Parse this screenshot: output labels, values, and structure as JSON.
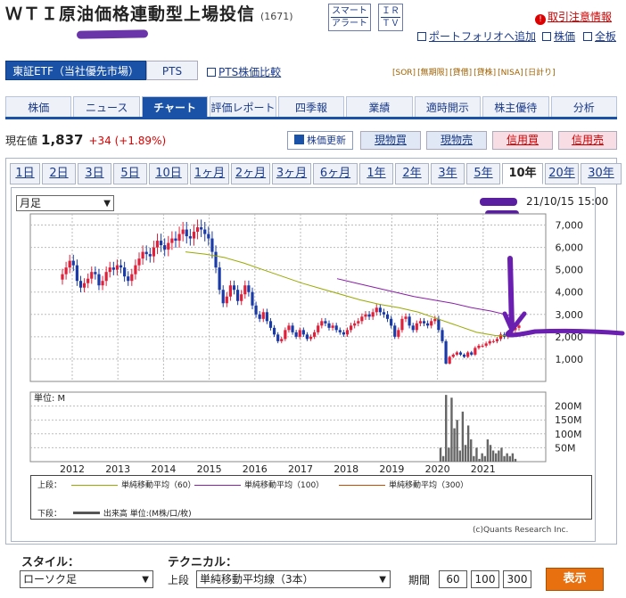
{
  "header": {
    "title": "ＷＴＩ原油価格連動型上場投信",
    "code": "(1671)",
    "smart_alert": [
      "スマート",
      "アラート"
    ],
    "ir_tv": [
      "ＩＲ",
      "ＴＶ"
    ],
    "warning": "取引注意情報",
    "portfolio_link": "ポートフォリオへ追加",
    "stock_link": "株価",
    "board_link": "全板"
  },
  "market": {
    "selected": "東証ETF（当社優先市場）",
    "pts": "PTS",
    "pts_compare": "PTS株価比較",
    "badges": [
      "[SOR]",
      "[無期限]",
      "[貸借]",
      "[貸株]",
      "[NISA]",
      "[日計り]"
    ]
  },
  "tabs": [
    {
      "label": "株価"
    },
    {
      "label": "ニュース"
    },
    {
      "label": "チャート"
    },
    {
      "label": "評価レポート"
    },
    {
      "label": "四季報"
    },
    {
      "label": "業績"
    },
    {
      "label": "適時開示"
    },
    {
      "label": "株主優待"
    },
    {
      "label": "分析"
    }
  ],
  "quote": {
    "label": "現在値",
    "price": "1,837",
    "change": "+34 (+1.89%)",
    "update": "株価更新",
    "buttons": [
      "現物買",
      "現物売",
      "信用買",
      "信用売"
    ]
  },
  "periods": [
    "1日",
    "2日",
    "3日",
    "5日",
    "10日",
    "1ヶ月",
    "2ヶ月",
    "3ヶ月",
    "6ヶ月",
    "1年",
    "2年",
    "3年",
    "5年",
    "10年",
    "20年",
    "30年"
  ],
  "active_period": "10年",
  "chart": {
    "interval": "月足",
    "timestamp": "21/10/15 15:00",
    "volume_unit": "単位: M",
    "legend_upper_label": "上段：",
    "legend_lower_label": "下段：",
    "ma_labels": [
      "単純移動平均（60）",
      "単純移動平均（100）",
      "単純移動平均（300）"
    ],
    "volume_label": "出来高 単位:(M株/口/枚)",
    "copyright": "(c)Quants Research Inc.",
    "colors": {
      "up": "#e0203a",
      "down": "#1a3aa8",
      "ma60": "#9aa800",
      "ma100": "#8a1fa8",
      "ma300": "#c84a00"
    }
  },
  "chart_data": {
    "type": "candlestick",
    "y_ticks": [
      "7,000",
      "6,000",
      "5,000",
      "4,000",
      "3,000",
      "2,000",
      "1,000"
    ],
    "ylim": [
      0,
      7500
    ],
    "x_ticks": [
      "2012",
      "2013",
      "2014",
      "2015",
      "2016",
      "2017",
      "2018",
      "2019",
      "2020",
      "2021"
    ],
    "volume_ticks": [
      "200M",
      "150M",
      "100M",
      "50M"
    ],
    "volume_ylim": [
      0,
      250
    ],
    "series": [
      {
        "name": "単純移動平均（60）"
      },
      {
        "name": "単純移動平均（100）"
      },
      {
        "name": "単純移動平均（300）"
      }
    ],
    "close": [
      4800,
      5100,
      5400,
      5200,
      4500,
      4200,
      4400,
      4600,
      4900,
      4800,
      4300,
      4500,
      4900,
      5100,
      5000,
      5200,
      5100,
      4700,
      4500,
      4800,
      5200,
      5500,
      5800,
      5700,
      5600,
      6000,
      6300,
      6100,
      5900,
      6200,
      6400,
      6300,
      6600,
      6800,
      6500,
      6400,
      6700,
      6900,
      6800,
      6600,
      6400,
      5800,
      5100,
      4100,
      3500,
      3800,
      4300,
      4100,
      3600,
      3900,
      4300,
      4000,
      3400,
      3000,
      2800,
      3100,
      2700,
      2400,
      2100,
      1800,
      1900,
      2300,
      2500,
      2200,
      2000,
      2300,
      2100,
      1900,
      2000,
      2200,
      2500,
      2700,
      2600,
      2400,
      2500,
      2300,
      2200,
      2100,
      2300,
      2500,
      2600,
      2700,
      2900,
      3000,
      2900,
      3100,
      3300,
      3100,
      3000,
      2800,
      2500,
      2000,
      2300,
      2800,
      2900,
      2500,
      2300,
      2600,
      2700,
      2600,
      2500,
      2700,
      2800,
      2300,
      1800,
      800,
      1100,
      1200,
      1300,
      1200,
      1100,
      1300,
      1200,
      1500,
      1600,
      1600,
      1700,
      1800,
      1800,
      1900,
      2100,
      2000,
      2100,
      2300,
      2400,
      2500
    ],
    "ma60": [
      5800,
      5700,
      5550,
      5300,
      5000,
      4700,
      4400,
      4150,
      3900,
      3650,
      3450,
      3300,
      3100,
      2800,
      2500,
      2200,
      2050,
      2050
    ],
    "ma100": [
      4600,
      4400,
      4200,
      4000,
      3800,
      3650,
      3500,
      3300,
      3150,
      2950
    ],
    "volume": [
      50,
      20,
      240,
      50,
      230,
      120,
      150,
      40,
      180,
      60,
      130,
      80,
      20,
      50,
      10,
      30,
      20,
      80,
      60,
      40,
      30,
      40,
      50,
      20,
      30,
      20,
      30,
      10
    ]
  },
  "form": {
    "style_label": "スタイル：",
    "style_value": "ローソク足",
    "technical_label": "テクニカル：",
    "upper_label": "上段",
    "technical_value": "単純移動平均線（3本）",
    "period_label": "期間",
    "periods": [
      "60",
      "100",
      "300"
    ],
    "submit": "表示"
  }
}
